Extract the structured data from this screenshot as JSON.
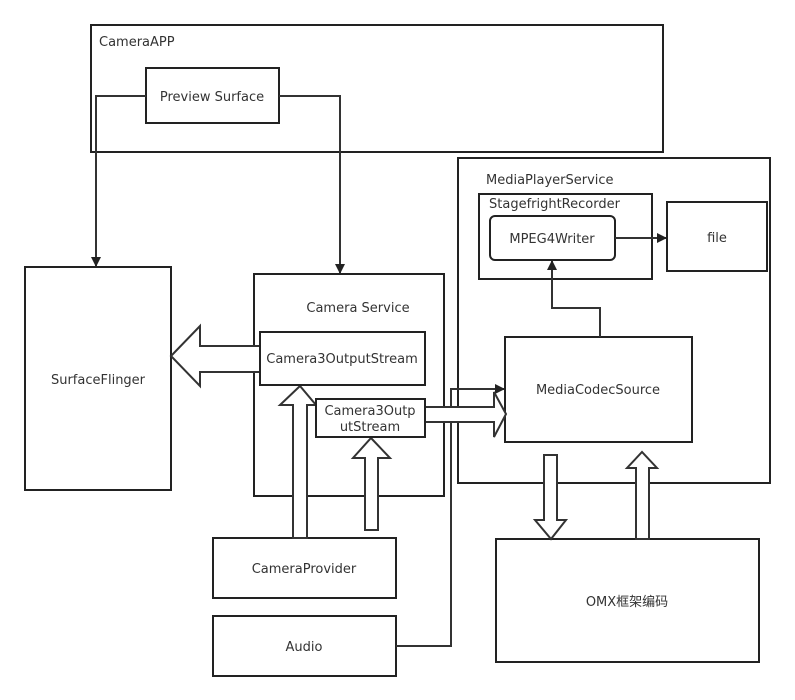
{
  "nodes": {
    "camera_app": "CameraAPP",
    "preview_surface": "Preview Surface",
    "surface_flinger": "SurfaceFlinger",
    "camera_service": "Camera Service",
    "camera3_output_stream_1": "Camera3OutputStream",
    "camera3_output_stream_2_line1": "Camera3Outp",
    "camera3_output_stream_2_line2": "utStream",
    "media_player_service": "MediaPlayerService",
    "stagefright_recorder": "StagefrightRecorder",
    "mpeg4_writer": "MPEG4Writer",
    "file": "file",
    "media_codec_source": "MediaCodecSource",
    "camera_provider": "CameraProvider",
    "audio": "Audio",
    "omx": "OMX框架编码"
  }
}
